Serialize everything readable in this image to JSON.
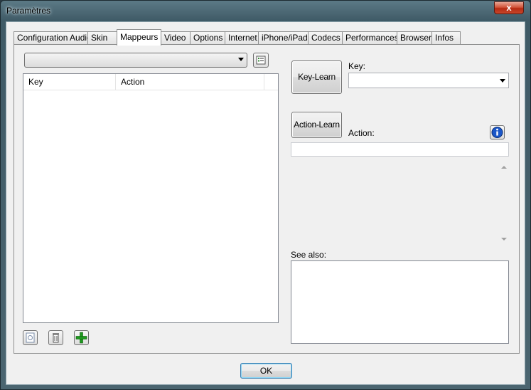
{
  "window": {
    "title": "Paramètres",
    "close_label": "x"
  },
  "tabs": [
    {
      "label": "Configuration Audio"
    },
    {
      "label": "Skin"
    },
    {
      "label": "Mappeurs",
      "active": true
    },
    {
      "label": "Video"
    },
    {
      "label": "Options"
    },
    {
      "label": "Internet"
    },
    {
      "label": "iPhone/iPad"
    },
    {
      "label": "Codecs"
    },
    {
      "label": "Performances"
    },
    {
      "label": "Browser"
    },
    {
      "label": "Infos"
    }
  ],
  "mapper": {
    "combo_value": "",
    "columns": [
      "Key",
      "Action"
    ],
    "rows": []
  },
  "right": {
    "key_learn_label": "Key-Learn",
    "action_learn_label": "Action-Learn",
    "key_label": "Key:",
    "key_value": "",
    "action_label": "Action:",
    "action_value": "",
    "see_also_label": "See also:"
  },
  "footer": {
    "ok_label": "OK"
  },
  "icons": {
    "close": "close-icon",
    "list": "list-icon",
    "info": "info-icon",
    "import": "import-icon",
    "delete": "trash-icon",
    "add": "plus-icon"
  },
  "colors": {
    "info_blue": "#1a56c8",
    "add_green": "#1f9a1f",
    "ok_border": "#3c7fb1"
  }
}
